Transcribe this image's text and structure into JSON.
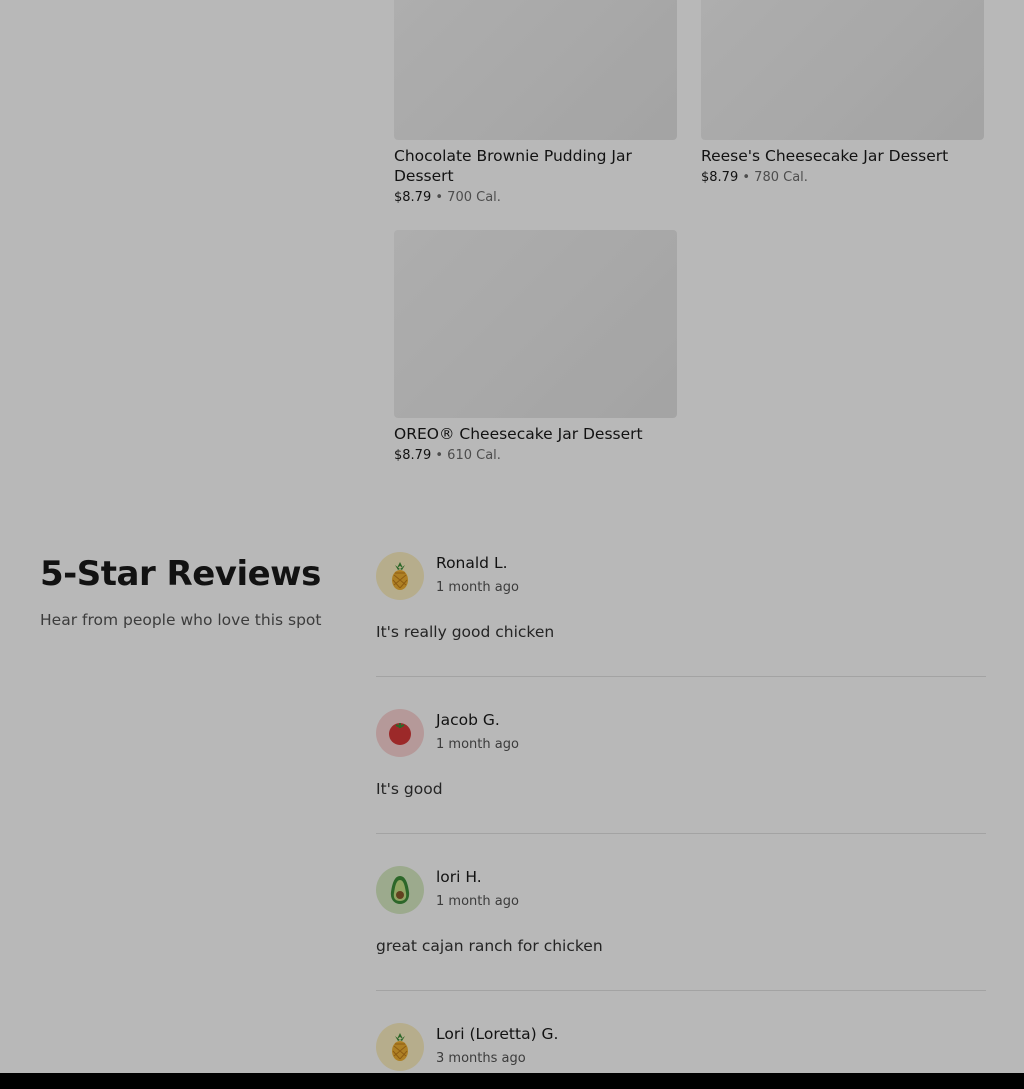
{
  "menu_items": [
    {
      "name": "Chocolate Brownie Pudding Jar Dessert",
      "price": "$8.79",
      "separator": "•",
      "calories": "700 Cal."
    },
    {
      "name": "Reese's Cheesecake Jar Dessert",
      "price": "$8.79",
      "separator": "•",
      "calories": "780 Cal."
    },
    {
      "name": "OREO® Cheesecake Jar Dessert",
      "price": "$8.79",
      "separator": "•",
      "calories": "610 Cal."
    }
  ],
  "reviews_section": {
    "title": "5-Star Reviews",
    "subtitle": "Hear from people who love this spot",
    "reviews": [
      {
        "name": "Ronald L.",
        "time": "1 month ago",
        "text": "It's really good chicken",
        "avatar_icon": "pineapple-icon",
        "avatar_bg": "#fdf0c2"
      },
      {
        "name": "Jacob G.",
        "time": "1 month ago",
        "text": "It's good",
        "avatar_icon": "tomato-icon",
        "avatar_bg": "#fbd5d5"
      },
      {
        "name": "lori H.",
        "time": "1 month ago",
        "text": "great cajan ranch for chicken",
        "avatar_icon": "avocado-icon",
        "avatar_bg": "#d8ecc4"
      },
      {
        "name": "Lori (Loretta) G.",
        "time": "3 months ago",
        "text": "",
        "avatar_icon": "pineapple-icon",
        "avatar_bg": "#fdf0c2"
      }
    ]
  }
}
